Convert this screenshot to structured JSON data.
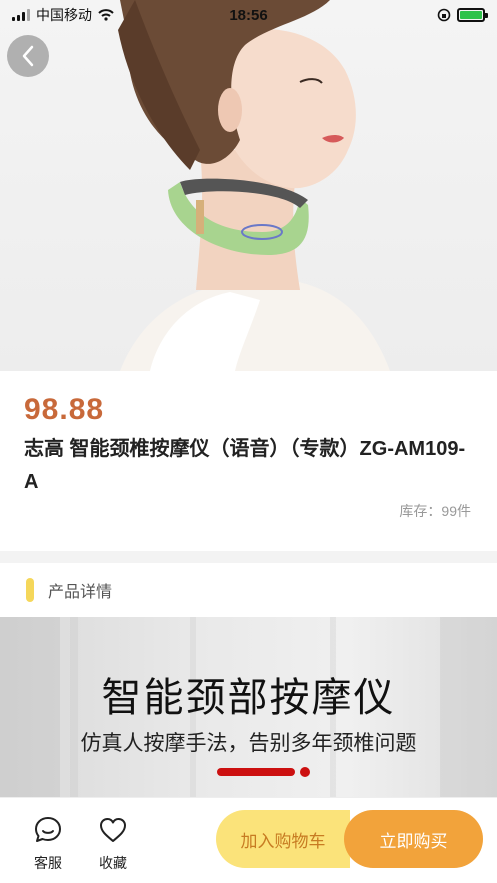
{
  "status": {
    "carrier": "中国移动",
    "time": "18:56"
  },
  "product": {
    "price": "98.88",
    "title": "志高 智能颈椎按摩仪（语音）（专款）ZG-AM109-A",
    "stock": "库存：99件",
    "image_icon": "product-photo-neck-massager"
  },
  "detail": {
    "section_label": "产品详情"
  },
  "banner": {
    "title": "智能颈部按摩仪",
    "subtitle": "仿真人按摩手法，告别多年颈椎问题"
  },
  "bottom": {
    "service_label": "客服",
    "favorite_label": "收藏",
    "add_cart_label": "加入购物车",
    "buy_now_label": "立即购买"
  },
  "colors": {
    "price": "#c8693a",
    "accent_yellow": "#fbe37a",
    "accent_orange": "#f2a33b",
    "section_bar": "#f5d75a",
    "banner_line": "#cc1010"
  }
}
